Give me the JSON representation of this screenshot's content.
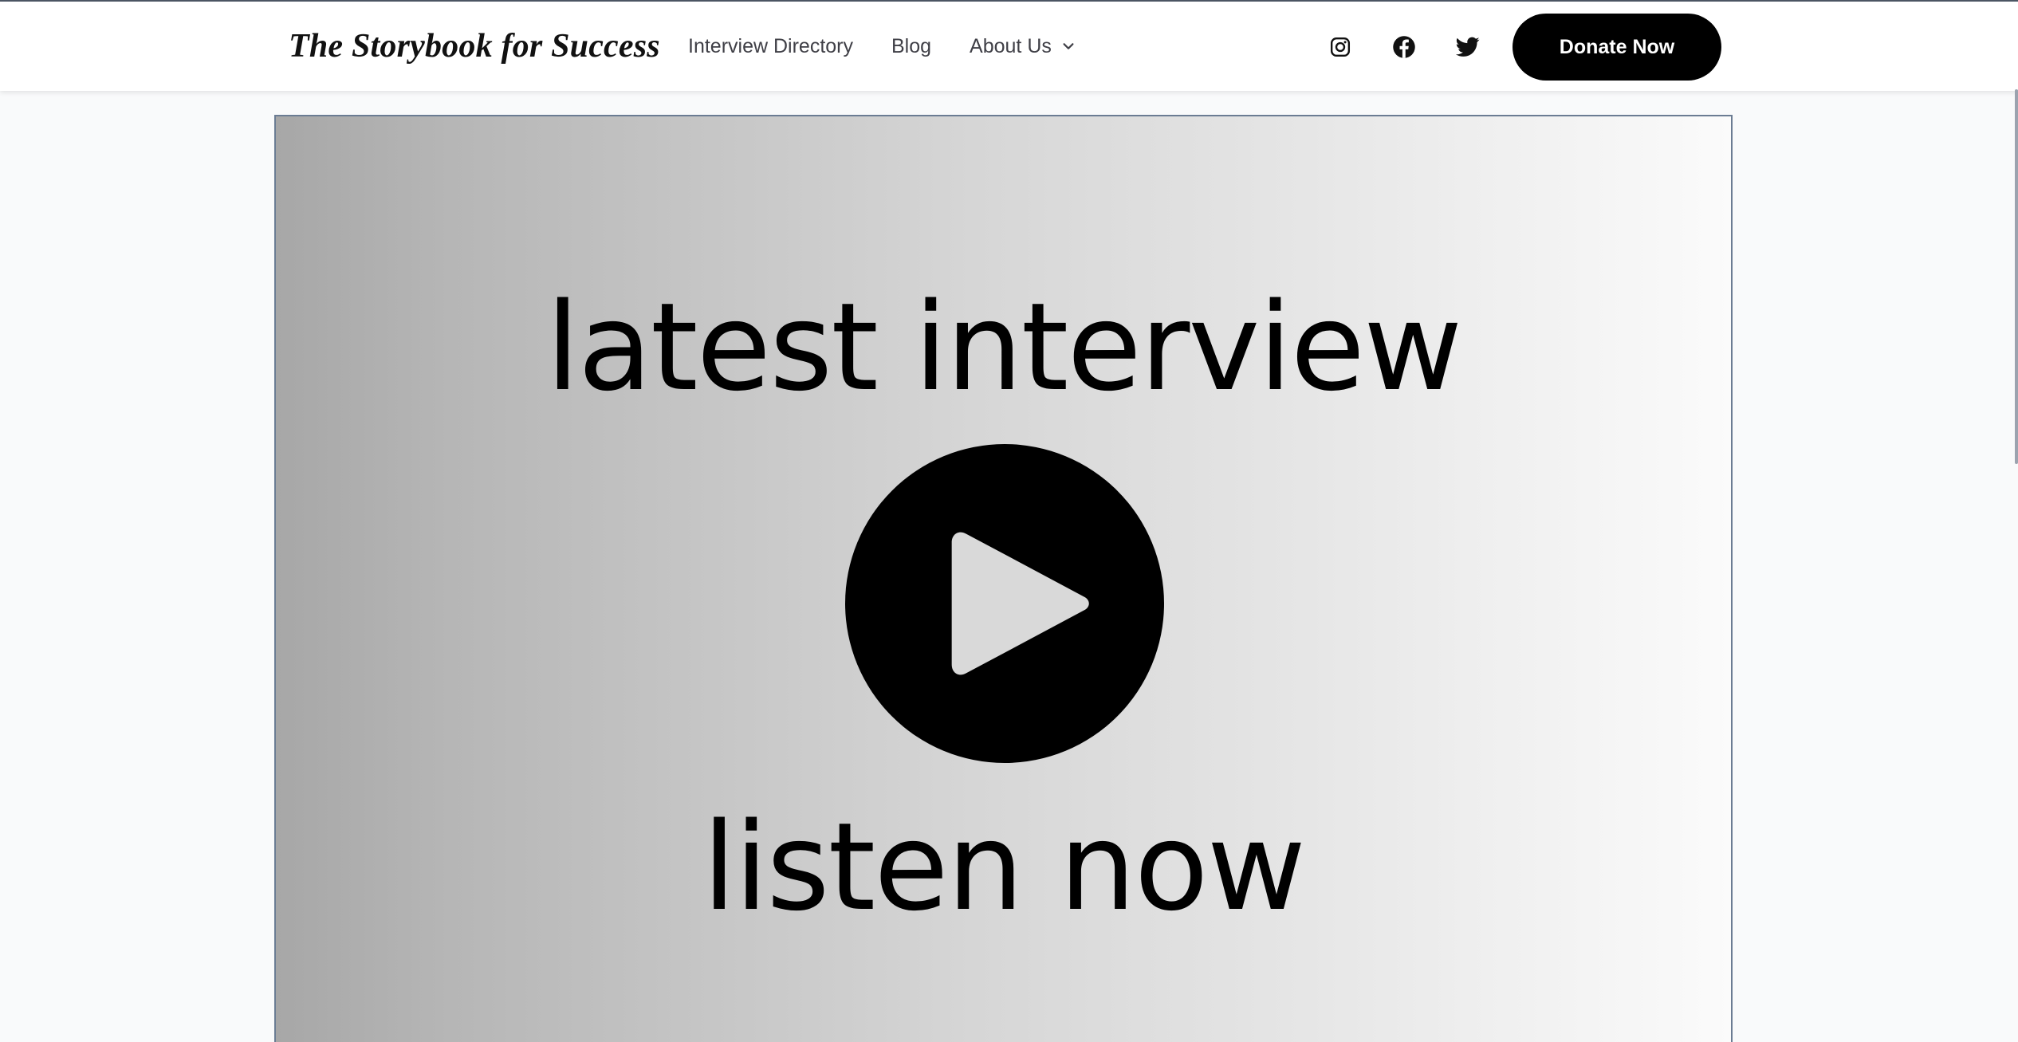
{
  "header": {
    "logo_text": "The Storybook for Success",
    "nav": [
      {
        "label": "Interview Directory"
      },
      {
        "label": "Blog"
      },
      {
        "label": "About Us",
        "has_dropdown": true
      }
    ],
    "social": [
      "instagram-icon",
      "facebook-icon",
      "twitter-icon"
    ],
    "donate_label": "Donate Now"
  },
  "hero": {
    "title": "latest interview",
    "cta": "listen now",
    "icon": "play-icon",
    "gradient_from": "#a7a7a7",
    "gradient_to": "#fbfbfb"
  },
  "colors": {
    "header_bg": "#ffffff",
    "page_bg": "#f9fafb",
    "button_bg": "#000000",
    "button_text": "#ffffff",
    "nav_text": "#3f3f46"
  }
}
